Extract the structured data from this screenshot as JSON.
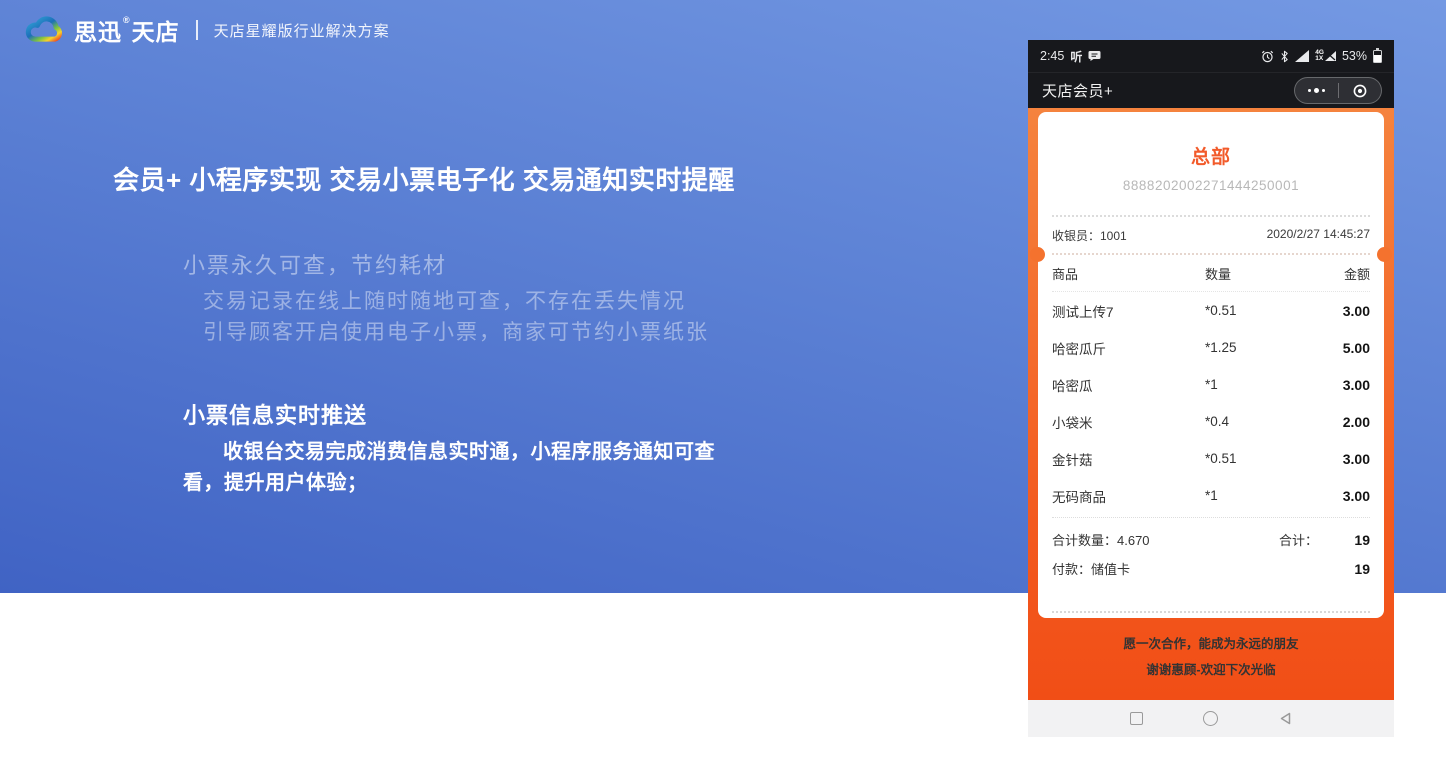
{
  "brand": {
    "name1": "思迅",
    "reg": "®",
    "name2": "天店",
    "subtitle": "天店星耀版行业解决方案"
  },
  "slide": {
    "headline": "会员+ 小程序实现 交易小票电子化 交易通知实时提醒",
    "feature1": {
      "title": "小票永久可查，节约耗材",
      "line1": "交易记录在线上随时随地可查，不存在丢失情况",
      "line2": "引导顾客开启使用电子小票，商家可节约小票纸张"
    },
    "feature2": {
      "title": "小票信息实时推送",
      "body": "收银台交易完成消费信息实时通，小程序服务通知可查看，提升用户体验；"
    }
  },
  "phone": {
    "status": {
      "time": "2:45",
      "app_glyph": "听",
      "network_top": "4G",
      "network_bottom": "1X",
      "battery_percent": "53%"
    },
    "title_bar": {
      "title": "天店会员+"
    },
    "receipt": {
      "store": "总部",
      "number": "8888202002271444250001",
      "cashier": "收银员：1001",
      "datetime": "2020/2/27 14:45:27",
      "columns": {
        "name": "商品",
        "qty": "数量",
        "amount": "金额"
      },
      "items": [
        {
          "name": "测试上传7",
          "qty": "*0.51",
          "amount": "3.00"
        },
        {
          "name": "哈密瓜斤",
          "qty": "*1.25",
          "amount": "5.00"
        },
        {
          "name": "哈密瓜",
          "qty": "*1",
          "amount": "3.00"
        },
        {
          "name": "小袋米",
          "qty": "*0.4",
          "amount": "2.00"
        },
        {
          "name": "金针菇",
          "qty": "*0.51",
          "amount": "3.00"
        },
        {
          "name": "无码商品",
          "qty": "*1",
          "amount": "3.00"
        }
      ],
      "total_qty": "合计数量：4.670",
      "total_label": "合计：",
      "total_value": "19",
      "payment": "付款：储值卡",
      "payment_value": "19",
      "footer1": "愿一次合作，能成为永远的朋友",
      "footer2": "谢谢惠顾-欢迎下次光临"
    }
  },
  "colors": {
    "slide_blue_top": "#7499E3",
    "slide_blue_bottom": "#4063C4",
    "phone_orange_top": "#F5833E",
    "phone_orange_bottom": "#F14E16",
    "receipt_accent": "#F25B2B",
    "statusbar_bg": "#17181C"
  }
}
